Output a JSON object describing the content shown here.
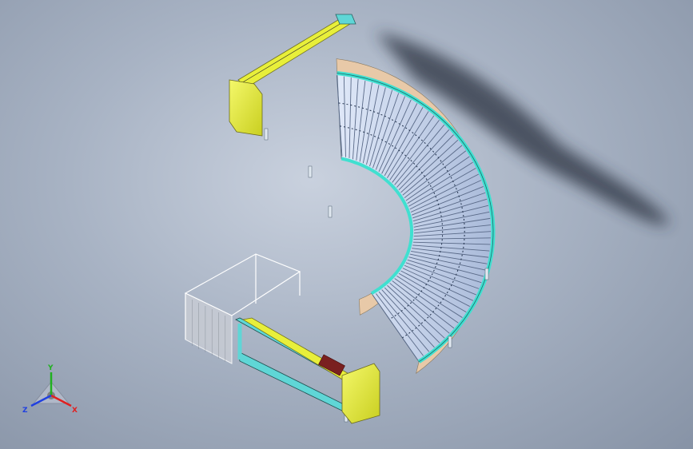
{
  "viewport": {
    "background_top": "#c9d1de",
    "background_bottom": "#8793a6"
  },
  "model": {
    "roller_color": "#b8c8e8",
    "side_rail_color": "#40e0d0",
    "guard_color": "#e8c9a8",
    "end_cap_color": "#e8ef3a",
    "frame_color": "#5fd6d6",
    "cage_color": "#ffffff"
  },
  "triad": {
    "x_label": "X",
    "y_label": "Y",
    "z_label": "Z",
    "x_color": "#e02020",
    "y_color": "#20b020",
    "z_color": "#2040e0"
  }
}
